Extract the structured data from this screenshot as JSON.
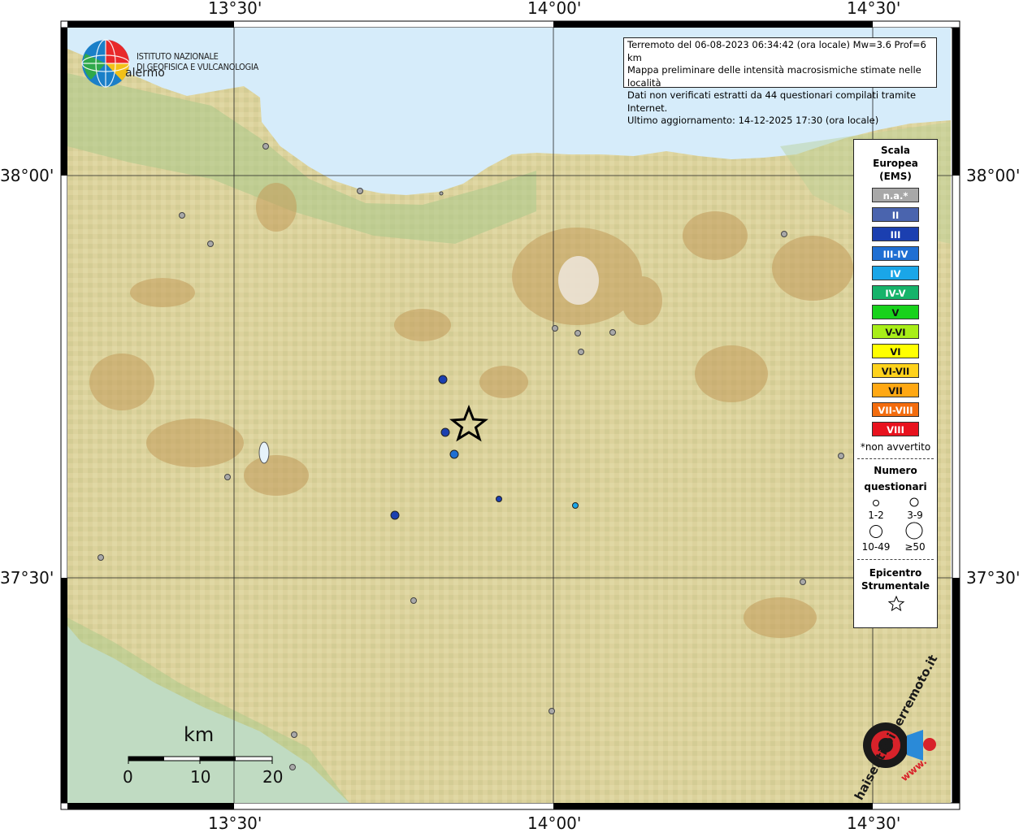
{
  "coords": {
    "top": [
      "13°30'",
      "14°00'",
      "14°30'"
    ],
    "bottom": [
      "13°30'",
      "14°00'",
      "14°30'"
    ],
    "left": [
      "38°00'",
      "37°30'"
    ],
    "right": [
      "38°00'",
      "37°30'"
    ]
  },
  "info": {
    "line1": "Terremoto del 06-08-2023 06:34:42 (ora locale) Mw=3.6 Prof=6 km",
    "line2": "Mappa preliminare delle intensità macrosismiche stimate nelle località",
    "line3": "Dati non verificati estratti da 44 questionari compilati tramite Internet.",
    "line4": "Ultimo aggiornamento: 14-12-2025 17:30 (ora locale)"
  },
  "logo": {
    "ingv_line1": "ISTITUTO NAZIONALE",
    "ingv_line2": "DI GEOFISICA E VULCANOLOGIA",
    "palermo_fragment": "alermo",
    "haisentito": "haisentitoilterremoto.it",
    "www": "www."
  },
  "legend": {
    "title": [
      "Scala",
      "Europea",
      "(EMS)"
    ],
    "classes": [
      {
        "label": "n.a.*",
        "color": "#a8a8a8"
      },
      {
        "label": "II",
        "color": "#4a64ae"
      },
      {
        "label": "III",
        "color": "#1b3fb0"
      },
      {
        "label": "III-IV",
        "color": "#1f6fd3"
      },
      {
        "label": "IV",
        "color": "#1aa6e8"
      },
      {
        "label": "IV-V",
        "color": "#16b36a"
      },
      {
        "label": "V",
        "color": "#18d21c"
      },
      {
        "label": "V-VI",
        "color": "#a8ee18"
      },
      {
        "label": "VI",
        "color": "#ffff00"
      },
      {
        "label": "VI-VII",
        "color": "#ffd21c"
      },
      {
        "label": "VII",
        "color": "#ffa814"
      },
      {
        "label": "VII-VIII",
        "color": "#f36c0e"
      },
      {
        "label": "VIII",
        "color": "#e8121e"
      }
    ],
    "note": "*non avvertito",
    "count_title": [
      "Numero",
      "questionari"
    ],
    "count_classes": [
      "1-2",
      "3-9",
      "10-49",
      "≥50"
    ],
    "epicenter_title": [
      "Epicentro",
      "Strumentale"
    ]
  },
  "scale_bar": {
    "unit": "km",
    "ticks": [
      "0",
      "10",
      "20"
    ]
  },
  "localities": [
    {
      "intensity": "III",
      "color": "#1b3fb0",
      "questionnaires": "3-9"
    },
    {
      "intensity": "III",
      "color": "#1b3fb0",
      "questionnaires": "3-9"
    },
    {
      "intensity": "III-IV",
      "color": "#1f6fd3",
      "questionnaires": "3-9"
    },
    {
      "intensity": "III",
      "color": "#1b3fb0",
      "questionnaires": "3-9"
    },
    {
      "intensity": "III",
      "color": "#1b3fb0",
      "questionnaires": "1-2"
    },
    {
      "intensity": "IV",
      "color": "#1aa6e8",
      "questionnaires": "1-2"
    }
  ],
  "not_felt_count": 18,
  "colors": {
    "sea": "#d6ecfa",
    "land": "#d9d39b",
    "frame": "#000000"
  }
}
